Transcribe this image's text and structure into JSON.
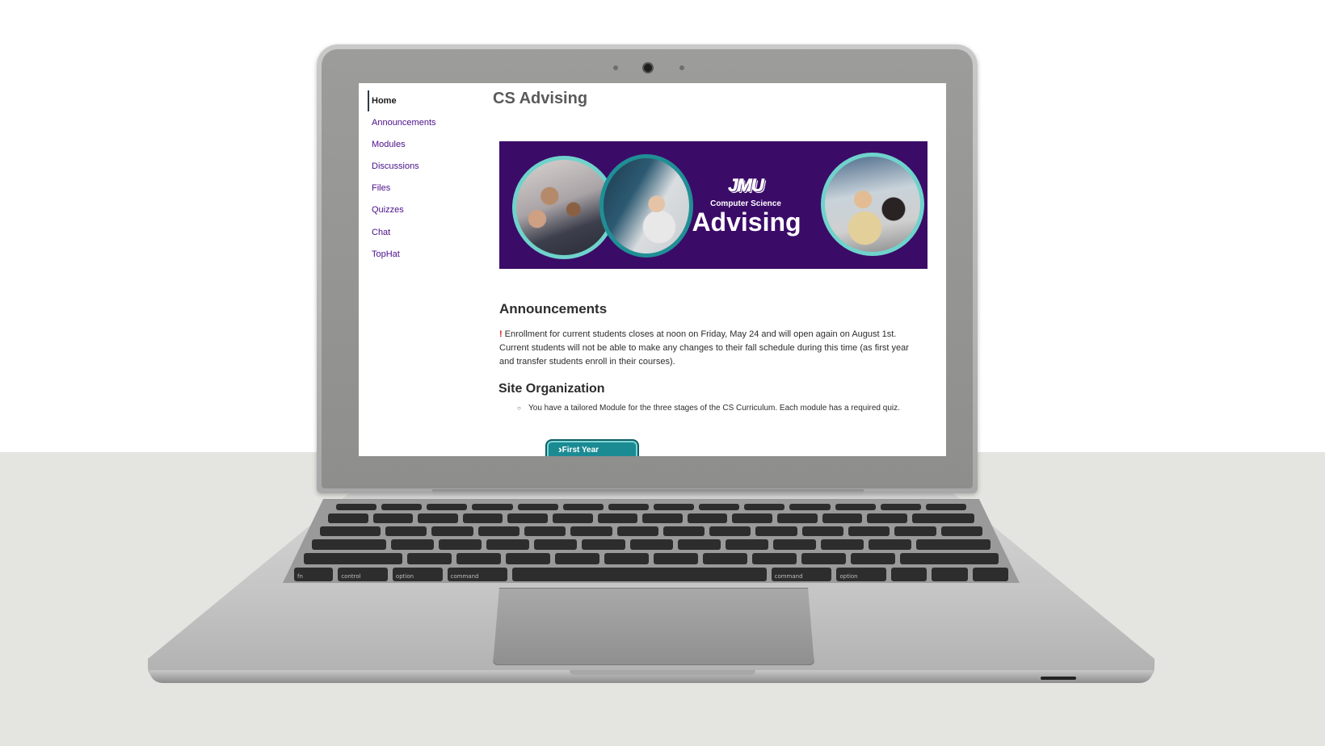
{
  "sidebar": {
    "items": [
      {
        "label": "Home",
        "active": true
      },
      {
        "label": "Announcements"
      },
      {
        "label": "Modules"
      },
      {
        "label": "Discussions"
      },
      {
        "label": "Files"
      },
      {
        "label": "Quizzes"
      },
      {
        "label": "Chat"
      },
      {
        "label": "TopHat"
      }
    ]
  },
  "page": {
    "title": "CS Advising"
  },
  "banner": {
    "logo": "JMU",
    "subtitle": "Computer Science",
    "title": "Advising"
  },
  "announcements": {
    "heading": "Announcements",
    "icon": "!",
    "text": "Enrollment for current students closes at noon on Friday, May 24 and will open again on August 1st. Current students will not be able to make any changes to their fall schedule during this time (as first year and transfer students enroll in their courses)."
  },
  "site_organization": {
    "heading": "Site Organization",
    "bullet": "You have a tailored Module for the three stages of the CS Curriculum. Each module has a required quiz.",
    "first_button": "First Year"
  },
  "keyboard": {
    "row4": [
      "fn",
      "control",
      "option",
      "command",
      "",
      "command",
      "option"
    ]
  },
  "colors": {
    "link": "#4b0f8a",
    "banner_bg": "#3b0b68",
    "accent_teal": "#1b8b93",
    "alert_red": "#d21b1b"
  }
}
